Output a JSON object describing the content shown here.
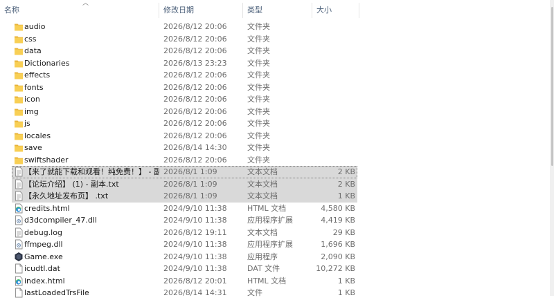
{
  "header": {
    "name": "名称",
    "date": "修改日期",
    "type": "类型",
    "size": "大小"
  },
  "files": [
    {
      "name": "audio",
      "date": "2026/8/12 20:06",
      "type": "文件夹",
      "size": "",
      "icon": "folder-icon",
      "selected": false
    },
    {
      "name": "css",
      "date": "2026/8/12 20:06",
      "type": "文件夹",
      "size": "",
      "icon": "folder-icon",
      "selected": false
    },
    {
      "name": "data",
      "date": "2026/8/12 20:06",
      "type": "文件夹",
      "size": "",
      "icon": "folder-icon",
      "selected": false
    },
    {
      "name": "Dictionaries",
      "date": "2026/8/13 23:23",
      "type": "文件夹",
      "size": "",
      "icon": "folder-icon",
      "selected": false
    },
    {
      "name": "effects",
      "date": "2026/8/12 20:06",
      "type": "文件夹",
      "size": "",
      "icon": "folder-icon",
      "selected": false
    },
    {
      "name": "fonts",
      "date": "2026/8/12 20:06",
      "type": "文件夹",
      "size": "",
      "icon": "folder-icon",
      "selected": false
    },
    {
      "name": "icon",
      "date": "2026/8/12 20:06",
      "type": "文件夹",
      "size": "",
      "icon": "folder-icon",
      "selected": false
    },
    {
      "name": "img",
      "date": "2026/8/12 20:06",
      "type": "文件夹",
      "size": "",
      "icon": "folder-icon",
      "selected": false
    },
    {
      "name": "js",
      "date": "2026/8/12 20:06",
      "type": "文件夹",
      "size": "",
      "icon": "folder-icon",
      "selected": false
    },
    {
      "name": "locales",
      "date": "2026/8/12 20:06",
      "type": "文件夹",
      "size": "",
      "icon": "folder-icon",
      "selected": false
    },
    {
      "name": "save",
      "date": "2026/8/14 14:30",
      "type": "文件夹",
      "size": "",
      "icon": "folder-icon",
      "selected": false
    },
    {
      "name": "swiftshader",
      "date": "2026/8/12 20:06",
      "type": "文件夹",
      "size": "",
      "icon": "folder-icon",
      "selected": false
    },
    {
      "name": "【来了就能下载和观看！纯免费！】 - 副...",
      "date": "2026/8/1 1:09",
      "type": "文本文档",
      "size": "2 KB",
      "icon": "text-file-icon",
      "selected": true
    },
    {
      "name": "【论坛介绍】 (1) - 副本.txt",
      "date": "2026/8/1 1:09",
      "type": "文本文档",
      "size": "2 KB",
      "icon": "text-file-icon",
      "selected": true
    },
    {
      "name": "【永久地址发布页】 .txt",
      "date": "2026/8/1 1:09",
      "type": "文本文档",
      "size": "1 KB",
      "icon": "text-file-icon",
      "selected": true
    },
    {
      "name": "credits.html",
      "date": "2024/9/10 11:38",
      "type": "HTML 文档",
      "size": "4,580 KB",
      "icon": "edge-html-icon",
      "selected": false
    },
    {
      "name": "d3dcompiler_47.dll",
      "date": "2024/9/10 11:38",
      "type": "应用程序扩展",
      "size": "4,419 KB",
      "icon": "dll-file-icon",
      "selected": false
    },
    {
      "name": "debug.log",
      "date": "2026/8/12 19:11",
      "type": "文本文档",
      "size": "29 KB",
      "icon": "text-file-icon",
      "selected": false
    },
    {
      "name": "ffmpeg.dll",
      "date": "2024/9/10 11:38",
      "type": "应用程序扩展",
      "size": "1,696 KB",
      "icon": "dll-file-icon",
      "selected": false
    },
    {
      "name": "Game.exe",
      "date": "2024/9/10 11:38",
      "type": "应用程序",
      "size": "2,090 KB",
      "icon": "game-exe-icon",
      "selected": false
    },
    {
      "name": "icudtl.dat",
      "date": "2024/9/10 11:38",
      "type": "DAT 文件",
      "size": "10,272 KB",
      "icon": "blank-file-icon",
      "selected": false
    },
    {
      "name": "index.html",
      "date": "2026/8/12 20:01",
      "type": "HTML 文档",
      "size": "1 KB",
      "icon": "edge-html-icon",
      "selected": false
    },
    {
      "name": "lastLoadedTrsFile",
      "date": "2026/8/14 14:31",
      "type": "文件",
      "size": "1 KB",
      "icon": "blank-file-icon",
      "selected": false
    }
  ],
  "colors": {
    "folder": "#f5c542",
    "selected_bg": "#d9d9d9",
    "header_text": "#4c607a"
  }
}
